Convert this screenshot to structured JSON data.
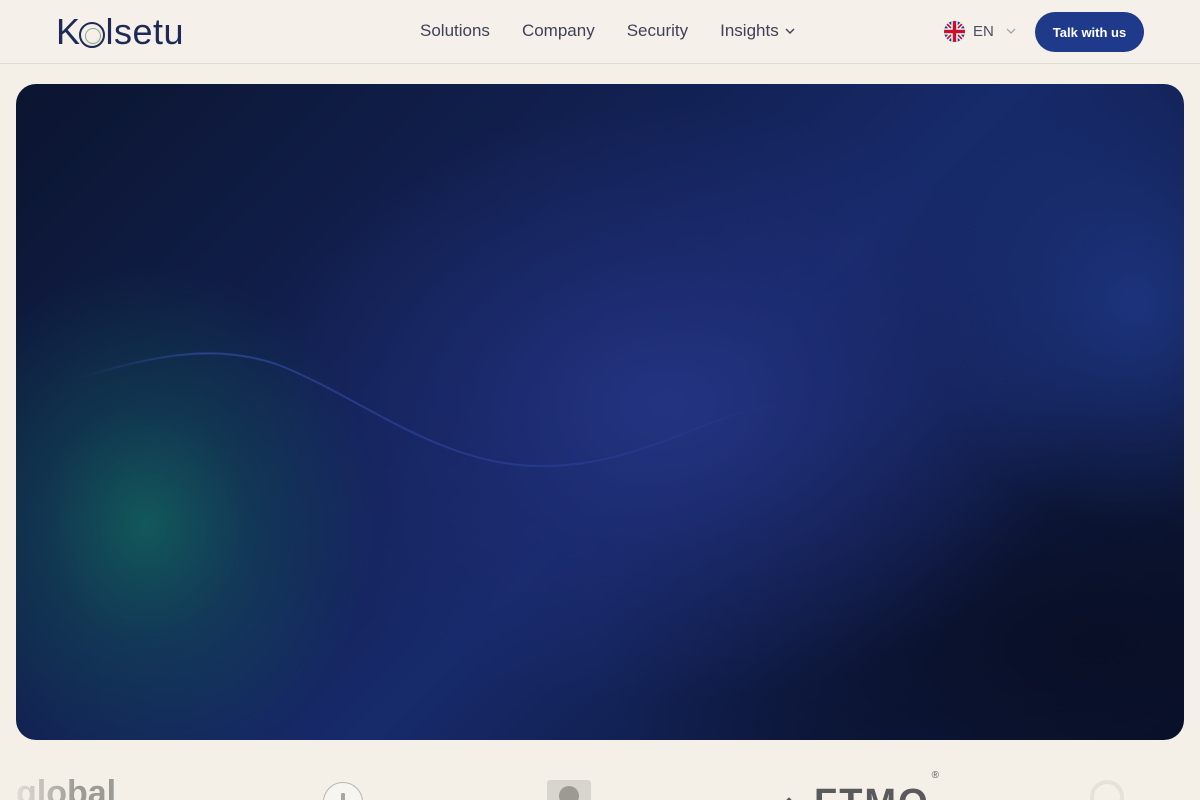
{
  "brand": {
    "name_first": "K",
    "name_rest": "lsetu"
  },
  "nav": {
    "items": [
      {
        "label": "Solutions"
      },
      {
        "label": "Company"
      },
      {
        "label": "Security"
      },
      {
        "label": "Insights"
      }
    ]
  },
  "language": {
    "code": "EN",
    "flag_icon": "uk-flag-icon"
  },
  "cta": {
    "label": "Talk with us"
  },
  "colors": {
    "accent": "#1f3a8a",
    "hero_dark": "#0b1530",
    "hero_blue": "#172a6b",
    "hero_teal": "#12625c",
    "page_bg": "#f4f0e8"
  },
  "partner_logos": {
    "global_text": "global",
    "ftmo_text": "FTMO",
    "ftmo_reg": "®"
  }
}
